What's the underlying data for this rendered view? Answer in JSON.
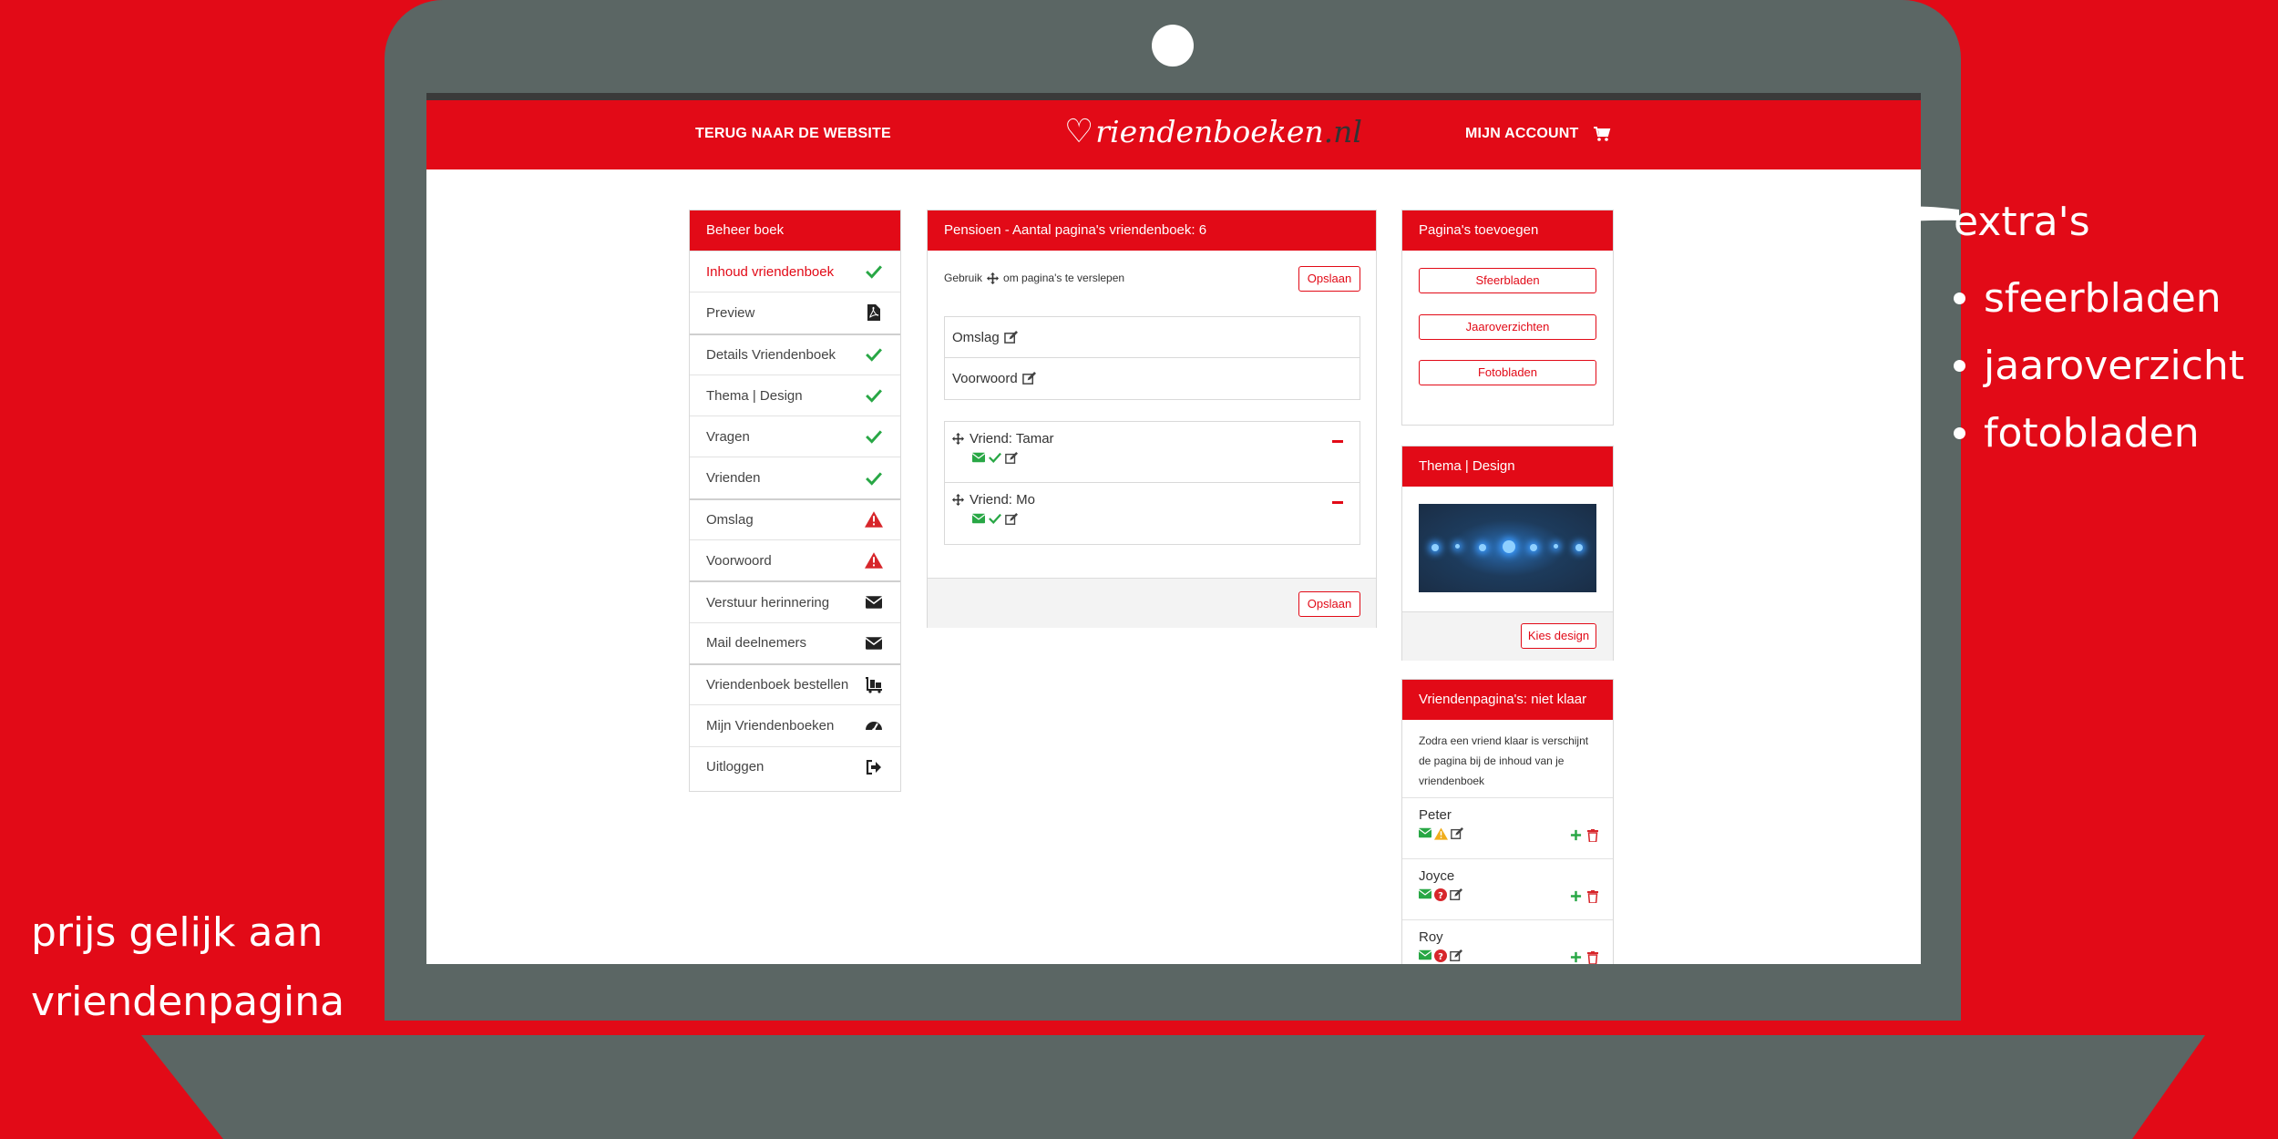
{
  "navbar": {
    "back_link": "TERUG NAAR DE WEBSITE",
    "logo_text": "riendenboeken",
    "logo_tld": ".nl",
    "account_link": "MIJN ACCOUNT",
    "cart_icon": "cart-icon"
  },
  "menu": {
    "title": "Beheer boek",
    "items": [
      {
        "label": "Inhoud vriendenboek",
        "icon": "check-icon"
      },
      {
        "label": "Preview",
        "icon": "pdf-icon"
      },
      {
        "label": "Details Vriendenboek",
        "icon": "check-icon"
      },
      {
        "label": "Thema | Design",
        "icon": "check-icon"
      },
      {
        "label": "Vragen",
        "icon": "check-icon"
      },
      {
        "label": "Vrienden",
        "icon": "check-icon"
      },
      {
        "label": "Omslag",
        "icon": "warning-icon"
      },
      {
        "label": "Voorwoord",
        "icon": "warning-icon"
      },
      {
        "label": "Verstuur herinnering",
        "icon": "envelope-icon"
      },
      {
        "label": "Mail deelnemers",
        "icon": "envelope-icon"
      },
      {
        "label": "Vriendenboek bestellen",
        "icon": "luggage-cart-icon"
      },
      {
        "label": "Mijn Vriendenboeken",
        "icon": "dashboard-icon"
      },
      {
        "label": "Uitloggen",
        "icon": "sign-out-icon"
      }
    ]
  },
  "content": {
    "title": "Pensioen - Aantal pagina's vriendenboek: 6",
    "hint_before": "Gebruik",
    "hint_after": "om pagina's te verslepen",
    "save_label": "Opslaan",
    "fixed_pages": [
      "Omslag",
      "Voorwoord"
    ],
    "friend_pages": [
      "Vriend: Tamar",
      "Vriend: Mo"
    ]
  },
  "add_pages": {
    "title": "Pagina's toevoegen",
    "buttons": [
      "Sfeerbladen",
      "Jaaroverzichten",
      "Fotobladen"
    ]
  },
  "theme": {
    "title": "Thema | Design",
    "choose_label": "Kies design"
  },
  "friends": {
    "title": "Vriendenpagina's: niet klaar",
    "note": "Zodra een vriend klaar is verschijnt de pagina bij de inhoud van je vriendenboek",
    "names": [
      "Peter",
      "Joyce",
      "Roy"
    ]
  },
  "annotations": {
    "extras_title": "extra's",
    "extras": [
      "sfeerbladen",
      "jaaroverzicht",
      "fotobladen"
    ],
    "price_line1": "prijs gelijk aan",
    "price_line2": "vriendenpagina"
  },
  "colors": {
    "brand_red": "#e20a17",
    "laptop_gray": "#5b6664",
    "success_green": "#28a745",
    "warning_red": "#d7262b"
  }
}
